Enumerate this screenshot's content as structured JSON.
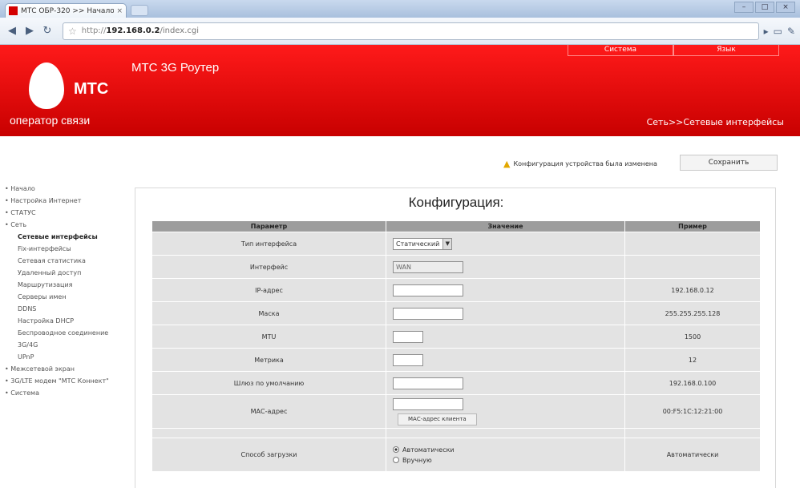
{
  "browser": {
    "tab_title": "МТС ОБР-320 >> Начало",
    "tab_close": "×",
    "url_proto": "http://",
    "url_host": "192.168.0.2",
    "url_path": "/index.cgi",
    "win_min": "–",
    "win_max": "□",
    "win_close": "×"
  },
  "header": {
    "brand": "МТС",
    "tagline": "оператор связи",
    "router_title": "МТС 3G Роутер",
    "top_links": [
      "Система",
      "Язык"
    ],
    "breadcrumb": "Сеть>>Сетевые интерфейсы"
  },
  "notice": {
    "text": "Конфигурация устройства была изменена",
    "save_label": "Сохранить"
  },
  "sidebar": {
    "items": [
      "Начало",
      "Настройка Интернет",
      "СТАТУС",
      "Сеть",
      "Сетевые интерфейсы",
      "Fix-интерфейсы",
      "Сетевая статистика",
      "Удаленный доступ",
      "Маршрутизация",
      "Серверы имен",
      "DDNS",
      "Настройка DHCP",
      "Беспроводное соединение",
      "3G/4G",
      "UPnP",
      "Межсетевой экран",
      "3G/LTE модем \"МТС Коннект\"",
      "Система"
    ]
  },
  "main": {
    "title": "Конфигурация:",
    "columns": [
      "Параметр",
      "Значение",
      "Пример"
    ],
    "rows": {
      "iface_type": {
        "label": "Тип интерфейса",
        "value": "Статический",
        "example": ""
      },
      "iface": {
        "label": "Интерфейс",
        "value": "WAN",
        "example": ""
      },
      "ip": {
        "label": "IP-адрес",
        "value": "",
        "example": "192.168.0.12"
      },
      "mask": {
        "label": "Маска",
        "value": "",
        "example": "255.255.255.128"
      },
      "mtu": {
        "label": "MTU",
        "value": "",
        "example": "1500"
      },
      "metric": {
        "label": "Метрика",
        "value": "",
        "example": "12"
      },
      "gateway": {
        "label": "Шлюз по умолчанию",
        "value": "",
        "example": "192.168.0.100"
      },
      "mac": {
        "label": "МАС-адрес",
        "value": "",
        "button": "МАС-адрес клиента",
        "example": "00:F5:1C:12:21:00"
      },
      "boot": {
        "label": "Способ загрузки",
        "option1": "Автоматически",
        "option2": "Вручную",
        "example": "Автоматически"
      }
    }
  }
}
